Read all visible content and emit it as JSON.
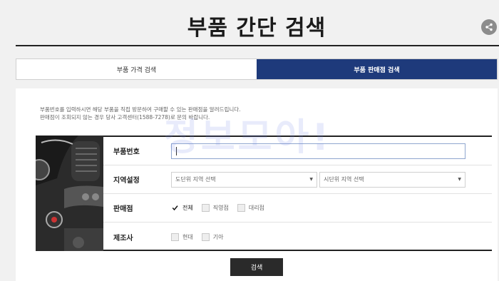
{
  "page": {
    "title": "부품 간단 검색"
  },
  "tabs": [
    {
      "label": "부품 가격 검색",
      "active": false
    },
    {
      "label": "부품 판매점 검색",
      "active": true
    }
  ],
  "intro": {
    "line1": "부품번호를 입력하시면 해당 부품을 직접 방문하여 구매할 수 있는 판매점을 알려드립니다.",
    "line2": "판매점이 조회되지 않는 경우 당사 고객센터(1588-7278)로 문의 바랍니다."
  },
  "form": {
    "part_number": {
      "label": "부품번호",
      "value": ""
    },
    "region": {
      "label": "지역설정",
      "province_placeholder": "도단위 지역 선택",
      "city_placeholder": "시단위 지역 선택"
    },
    "store": {
      "label": "판매점",
      "options": [
        {
          "label": "전체",
          "checked": true
        },
        {
          "label": "직영점",
          "checked": false
        },
        {
          "label": "대리점",
          "checked": false
        }
      ]
    },
    "maker": {
      "label": "제조사",
      "options": [
        {
          "label": "현대",
          "checked": false
        },
        {
          "label": "기아",
          "checked": false
        }
      ]
    }
  },
  "search_button": {
    "label": "검색"
  },
  "watermark": {
    "text": "정보모아!"
  },
  "colors": {
    "accent": "#1e3a7b",
    "button": "#2a2a2a"
  },
  "icons": {
    "share": "share-icon",
    "check": "check-icon"
  }
}
